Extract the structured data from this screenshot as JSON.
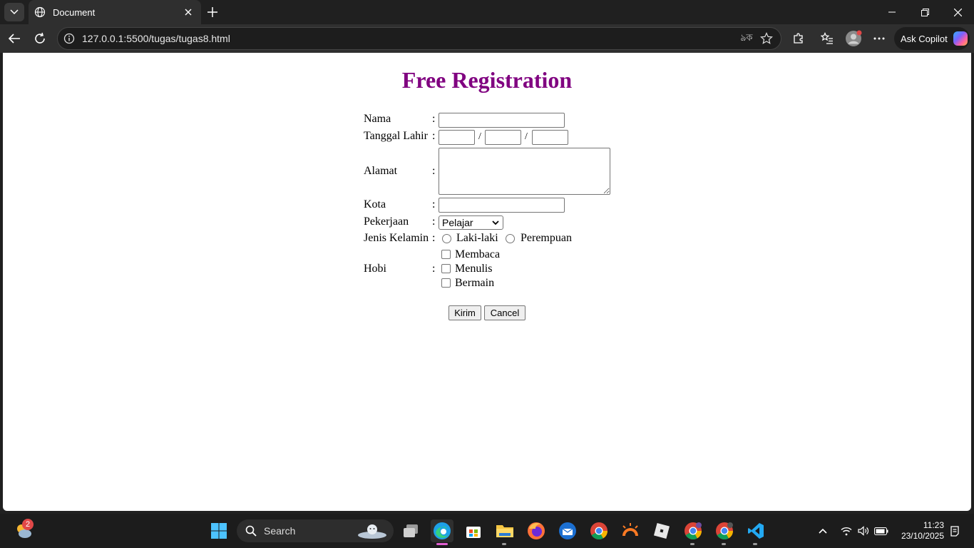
{
  "browser": {
    "tab_title": "Document",
    "url": "127.0.0.1:5500/tugas/tugas8.html",
    "ask_copilot_label": "Ask Copilot",
    "read_aloud_glyph": "ঌক"
  },
  "form": {
    "title": "Free Registration",
    "colon": ":",
    "date_separator": "/",
    "labels": {
      "nama": "Nama",
      "tanggal_lahir": "Tanggal Lahir",
      "alamat": "Alamat",
      "kota": "Kota",
      "pekerjaan": "Pekerjaan",
      "jenis_kelamin": "Jenis Kelamin",
      "hobi": "Hobi"
    },
    "values": {
      "nama": "",
      "tgl_day": "",
      "tgl_month": "",
      "tgl_year": "",
      "alamat": "",
      "kota": ""
    },
    "pekerjaan_selected": "Pelajar",
    "gender_options": [
      "Laki-laki",
      "Perempuan"
    ],
    "hobby_options": [
      "Membaca",
      "Menulis",
      "Bermain"
    ],
    "buttons": {
      "submit": "Kirim",
      "cancel": "Cancel"
    }
  },
  "taskbar": {
    "search_label": "Search",
    "weather_badge": "2",
    "time": "11:23",
    "date": "23/10/2025"
  },
  "colors": {
    "title": "#800080",
    "accent": "#0078d4"
  }
}
